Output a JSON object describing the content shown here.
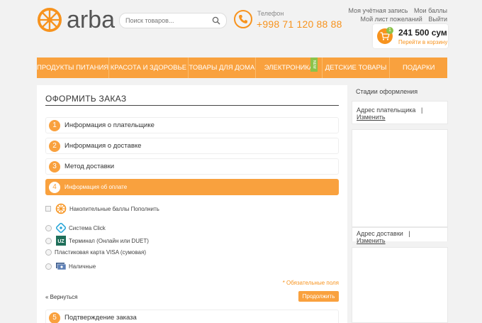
{
  "header": {
    "logo_text": "arba",
    "search_placeholder": "Поиск товаров...",
    "phone_label": "Телефон",
    "phone_number": "+998 71 120 88 88",
    "links_row1": [
      "Моя учётная запись",
      "Мои баллы"
    ],
    "links_row2": [
      "Мой лист пожеланий",
      "Выйти"
    ],
    "cart": {
      "count": "1",
      "total": "241 500 сум",
      "link": "Перейти в корзину"
    }
  },
  "nav": {
    "items": [
      "Продукты питания",
      "Красота и здоровье",
      "Товары для дома",
      "Электроника",
      "Детские товары",
      "Подарки"
    ],
    "new_badge": "NEW"
  },
  "checkout": {
    "title": "ОФОРМИТЬ ЗАКАЗ",
    "steps": [
      {
        "num": "1",
        "label": "Информация о плательщике"
      },
      {
        "num": "2",
        "label": "Информация о доставке"
      },
      {
        "num": "3",
        "label": "Метод доставки"
      },
      {
        "num": "4",
        "label": "Информация об оплате"
      },
      {
        "num": "5",
        "label": "Подтверждение заказа"
      }
    ],
    "options": [
      {
        "label": "Накопительные баллы Пополнить",
        "icon": "arba-wheel-icon"
      },
      {
        "label": "Система Click",
        "icon": "click-icon"
      },
      {
        "label": "Терминал (Онлайн или DUET)",
        "icon": "uz-icon"
      },
      {
        "label": "Пластиковая карта VISA (сумовая)",
        "icon": ""
      },
      {
        "label": "Наличные",
        "icon": "cash-icon"
      }
    ],
    "uz_text": "UZ",
    "required_note": "* Обязательные поля",
    "back_label": "« Вернуться",
    "continue_label": "Продолжить"
  },
  "sidebar": {
    "title": "Стадии оформления",
    "payer_address": "Адрес плательщика",
    "delivery_address": "Адрес доставки",
    "separator": "|",
    "change_label": "Изменить"
  },
  "colors": {
    "accent": "#f9a13e",
    "new_badge": "#8bc34a"
  }
}
